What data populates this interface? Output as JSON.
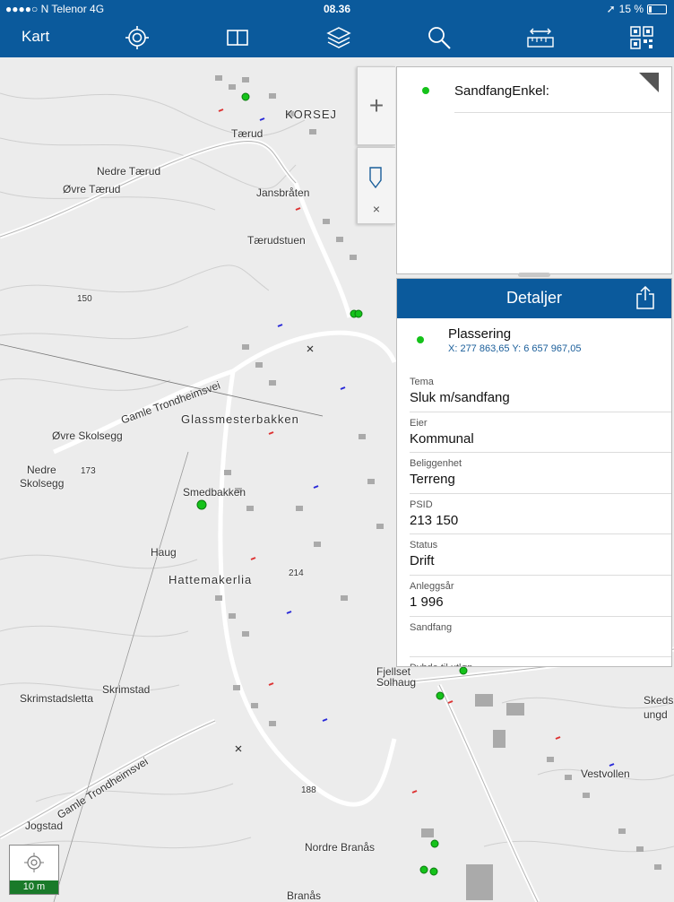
{
  "status": {
    "carrier": "●●●●○ N Telenor  4G",
    "time": "08.36",
    "battery": "15 %"
  },
  "toolbar": {
    "title": "Kart",
    "icons": [
      "location-target-icon",
      "map-book-icon",
      "layers-icon",
      "search-icon",
      "measure-icon",
      "qr-code-icon"
    ]
  },
  "map": {
    "labels": [
      {
        "text": "KORSEJ",
        "cls": "big"
      },
      {
        "text": "Nedre Tærud"
      },
      {
        "text": "Øvre Tærud"
      },
      {
        "text": "Jansbråten"
      },
      {
        "text": "Tærudstuen"
      },
      {
        "text": "Tærud"
      },
      {
        "text": "Gamle Trondheimsvei"
      },
      {
        "text": "Glassmesterbakken"
      },
      {
        "text": "Øvre Skolsegg"
      },
      {
        "text": "Nedre"
      },
      {
        "text": "Skolsegg"
      },
      {
        "text": "173"
      },
      {
        "text": "Smedbakken"
      },
      {
        "text": "Haug"
      },
      {
        "text": "Hattemakerlia"
      },
      {
        "text": "214"
      },
      {
        "text": "Skrimstadsletta"
      },
      {
        "text": "Skrimstad"
      },
      {
        "text": "Gamle Trondheimsvei"
      },
      {
        "text": "Jogstad"
      },
      {
        "text": "188"
      },
      {
        "text": "Nordre Branås"
      },
      {
        "text": "Branås"
      },
      {
        "text": "Fjellset"
      },
      {
        "text": "Solhaug"
      },
      {
        "text": "Vestvollen"
      },
      {
        "text": "Skeds"
      },
      {
        "text": "ungd"
      },
      {
        "text": "150"
      }
    ],
    "zoom_in": "+",
    "close": "×",
    "scale": "10 m"
  },
  "popup": {
    "title": "SandfangEnkel:"
  },
  "details": {
    "title": "Detaljer",
    "location_label": "Plassering",
    "coordinates": "X: 277 863,65 Y: 6 657 967,05",
    "fields": [
      {
        "key": "Tema",
        "value": "Sluk m/sandfang"
      },
      {
        "key": "Eier",
        "value": "Kommunal"
      },
      {
        "key": "Beliggenhet",
        "value": "Terreng"
      },
      {
        "key": "PSID",
        "value": "213 150"
      },
      {
        "key": "Status",
        "value": "Drift"
      },
      {
        "key": "Anleggsår",
        "value": "1 996"
      },
      {
        "key": "Sandfang",
        "value": ""
      },
      {
        "key": "Dybde til utløp",
        "value": ""
      }
    ]
  },
  "colors": {
    "brand": "#0b5a9c",
    "point": "#15c21a",
    "scale": "#1a7a2a"
  }
}
